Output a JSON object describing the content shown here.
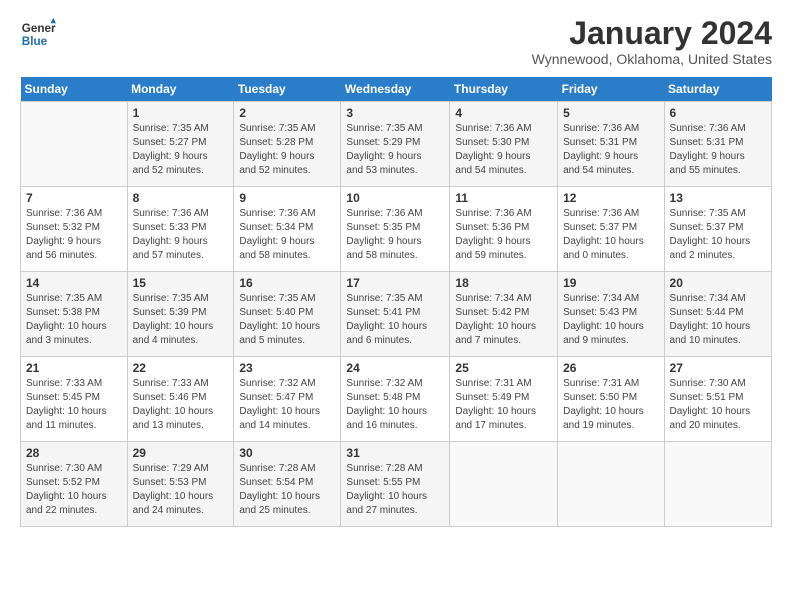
{
  "header": {
    "logo_line1": "General",
    "logo_line2": "Blue",
    "title": "January 2024",
    "subtitle": "Wynnewood, Oklahoma, United States"
  },
  "days_of_week": [
    "Sunday",
    "Monday",
    "Tuesday",
    "Wednesday",
    "Thursday",
    "Friday",
    "Saturday"
  ],
  "weeks": [
    [
      {
        "day": "",
        "info": ""
      },
      {
        "day": "1",
        "info": "Sunrise: 7:35 AM\nSunset: 5:27 PM\nDaylight: 9 hours\nand 52 minutes."
      },
      {
        "day": "2",
        "info": "Sunrise: 7:35 AM\nSunset: 5:28 PM\nDaylight: 9 hours\nand 52 minutes."
      },
      {
        "day": "3",
        "info": "Sunrise: 7:35 AM\nSunset: 5:29 PM\nDaylight: 9 hours\nand 53 minutes."
      },
      {
        "day": "4",
        "info": "Sunrise: 7:36 AM\nSunset: 5:30 PM\nDaylight: 9 hours\nand 54 minutes."
      },
      {
        "day": "5",
        "info": "Sunrise: 7:36 AM\nSunset: 5:31 PM\nDaylight: 9 hours\nand 54 minutes."
      },
      {
        "day": "6",
        "info": "Sunrise: 7:36 AM\nSunset: 5:31 PM\nDaylight: 9 hours\nand 55 minutes."
      }
    ],
    [
      {
        "day": "7",
        "info": "Sunrise: 7:36 AM\nSunset: 5:32 PM\nDaylight: 9 hours\nand 56 minutes."
      },
      {
        "day": "8",
        "info": "Sunrise: 7:36 AM\nSunset: 5:33 PM\nDaylight: 9 hours\nand 57 minutes."
      },
      {
        "day": "9",
        "info": "Sunrise: 7:36 AM\nSunset: 5:34 PM\nDaylight: 9 hours\nand 58 minutes."
      },
      {
        "day": "10",
        "info": "Sunrise: 7:36 AM\nSunset: 5:35 PM\nDaylight: 9 hours\nand 58 minutes."
      },
      {
        "day": "11",
        "info": "Sunrise: 7:36 AM\nSunset: 5:36 PM\nDaylight: 9 hours\nand 59 minutes."
      },
      {
        "day": "12",
        "info": "Sunrise: 7:36 AM\nSunset: 5:37 PM\nDaylight: 10 hours\nand 0 minutes."
      },
      {
        "day": "13",
        "info": "Sunrise: 7:35 AM\nSunset: 5:37 PM\nDaylight: 10 hours\nand 2 minutes."
      }
    ],
    [
      {
        "day": "14",
        "info": "Sunrise: 7:35 AM\nSunset: 5:38 PM\nDaylight: 10 hours\nand 3 minutes."
      },
      {
        "day": "15",
        "info": "Sunrise: 7:35 AM\nSunset: 5:39 PM\nDaylight: 10 hours\nand 4 minutes."
      },
      {
        "day": "16",
        "info": "Sunrise: 7:35 AM\nSunset: 5:40 PM\nDaylight: 10 hours\nand 5 minutes."
      },
      {
        "day": "17",
        "info": "Sunrise: 7:35 AM\nSunset: 5:41 PM\nDaylight: 10 hours\nand 6 minutes."
      },
      {
        "day": "18",
        "info": "Sunrise: 7:34 AM\nSunset: 5:42 PM\nDaylight: 10 hours\nand 7 minutes."
      },
      {
        "day": "19",
        "info": "Sunrise: 7:34 AM\nSunset: 5:43 PM\nDaylight: 10 hours\nand 9 minutes."
      },
      {
        "day": "20",
        "info": "Sunrise: 7:34 AM\nSunset: 5:44 PM\nDaylight: 10 hours\nand 10 minutes."
      }
    ],
    [
      {
        "day": "21",
        "info": "Sunrise: 7:33 AM\nSunset: 5:45 PM\nDaylight: 10 hours\nand 11 minutes."
      },
      {
        "day": "22",
        "info": "Sunrise: 7:33 AM\nSunset: 5:46 PM\nDaylight: 10 hours\nand 13 minutes."
      },
      {
        "day": "23",
        "info": "Sunrise: 7:32 AM\nSunset: 5:47 PM\nDaylight: 10 hours\nand 14 minutes."
      },
      {
        "day": "24",
        "info": "Sunrise: 7:32 AM\nSunset: 5:48 PM\nDaylight: 10 hours\nand 16 minutes."
      },
      {
        "day": "25",
        "info": "Sunrise: 7:31 AM\nSunset: 5:49 PM\nDaylight: 10 hours\nand 17 minutes."
      },
      {
        "day": "26",
        "info": "Sunrise: 7:31 AM\nSunset: 5:50 PM\nDaylight: 10 hours\nand 19 minutes."
      },
      {
        "day": "27",
        "info": "Sunrise: 7:30 AM\nSunset: 5:51 PM\nDaylight: 10 hours\nand 20 minutes."
      }
    ],
    [
      {
        "day": "28",
        "info": "Sunrise: 7:30 AM\nSunset: 5:52 PM\nDaylight: 10 hours\nand 22 minutes."
      },
      {
        "day": "29",
        "info": "Sunrise: 7:29 AM\nSunset: 5:53 PM\nDaylight: 10 hours\nand 24 minutes."
      },
      {
        "day": "30",
        "info": "Sunrise: 7:28 AM\nSunset: 5:54 PM\nDaylight: 10 hours\nand 25 minutes."
      },
      {
        "day": "31",
        "info": "Sunrise: 7:28 AM\nSunset: 5:55 PM\nDaylight: 10 hours\nand 27 minutes."
      },
      {
        "day": "",
        "info": ""
      },
      {
        "day": "",
        "info": ""
      },
      {
        "day": "",
        "info": ""
      }
    ]
  ]
}
